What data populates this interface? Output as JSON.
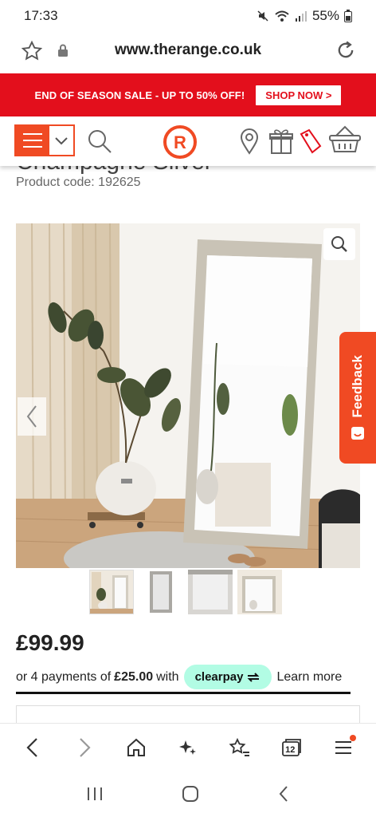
{
  "status": {
    "time": "17:33",
    "battery": "55%"
  },
  "browser": {
    "url": "www.therange.co.uk"
  },
  "promo": {
    "text": "END OF SEASON SALE - UP TO 50% OFF!",
    "button": "SHOP NOW >"
  },
  "product": {
    "name_partial": "Champagne Silver",
    "code": "Product code: 192625",
    "price": "£99.99"
  },
  "clearpay": {
    "prefix": "or 4 payments of",
    "amount": "£25.00",
    "with": "with",
    "brand": "clearpay",
    "learn_more": "Learn more"
  },
  "feedback": {
    "label": "Feedback"
  },
  "tabs": {
    "count": "12"
  },
  "colors": {
    "brand_orange": "#f04a23",
    "promo_red": "#e30f1c",
    "clearpay_mint": "#b2fce4"
  }
}
